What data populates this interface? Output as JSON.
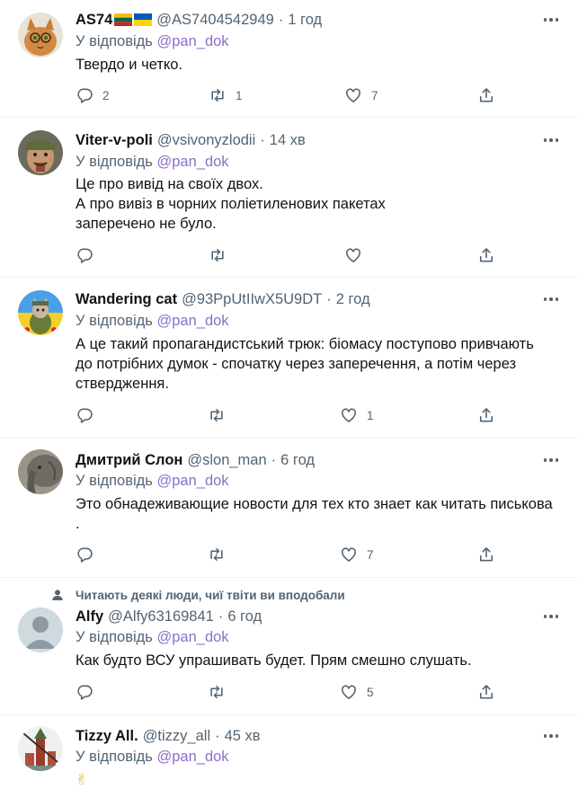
{
  "reply_prefix": "У відповідь",
  "reply_handle": "@pan_dok",
  "separator": "·",
  "tweets": [
    {
      "name": "AS74",
      "handle": "@AS7404542949",
      "time": "1 год",
      "text": [
        "Твердо и четко."
      ],
      "replies": "2",
      "retweets": "1",
      "likes": "7"
    },
    {
      "name": "Viter-v-poli",
      "handle": "@vsivonyzlodii",
      "time": "14 хв",
      "text": [
        "Це про вивід на своїх двох.",
        "А про вивіз в чорних поліетиленових пакетах",
        "заперечено не було."
      ],
      "replies": "",
      "retweets": "",
      "likes": ""
    },
    {
      "name": "Wandering cat",
      "handle": "@93PpUtIIwX5U9DT",
      "time": "2 год",
      "text": [
        "А це такий пропагандистський трюк: біомасу поступово привчають",
        "до потрібних думок - спочатку через заперечення, а потім через",
        "ствердження."
      ],
      "replies": "",
      "retweets": "",
      "likes": "1"
    },
    {
      "name": "Дмитрий Слон",
      "handle": "@slon_man",
      "time": "6 год",
      "text": [
        "Это обнадеживающие новости для тех кто знает как читать писькова",
        "."
      ],
      "replies": "",
      "retweets": "",
      "likes": "7"
    },
    {
      "social_context": "Читають деякі люди, чиї твіти ви вподобали",
      "name": "Alfy",
      "handle": "@Alfy63169841",
      "time": "6 год",
      "text": [
        "Как будто ВСУ упрашивать будет. Прям смешно слушать."
      ],
      "replies": "",
      "retweets": "",
      "likes": "5"
    },
    {
      "name": "Tizzy All.",
      "handle": "@tizzy_all",
      "time": "45 хв",
      "text": [
        "✌"
      ],
      "replies": "",
      "retweets": "",
      "likes": ""
    }
  ],
  "icons": {
    "reply": "reply-icon",
    "retweet": "retweet-icon",
    "like": "like-icon",
    "share": "share-icon",
    "more": "more-icon",
    "person": "person-icon"
  },
  "colors": {
    "link": "#8b6fc9",
    "secondary": "#536471",
    "divider": "#eff3f4"
  }
}
